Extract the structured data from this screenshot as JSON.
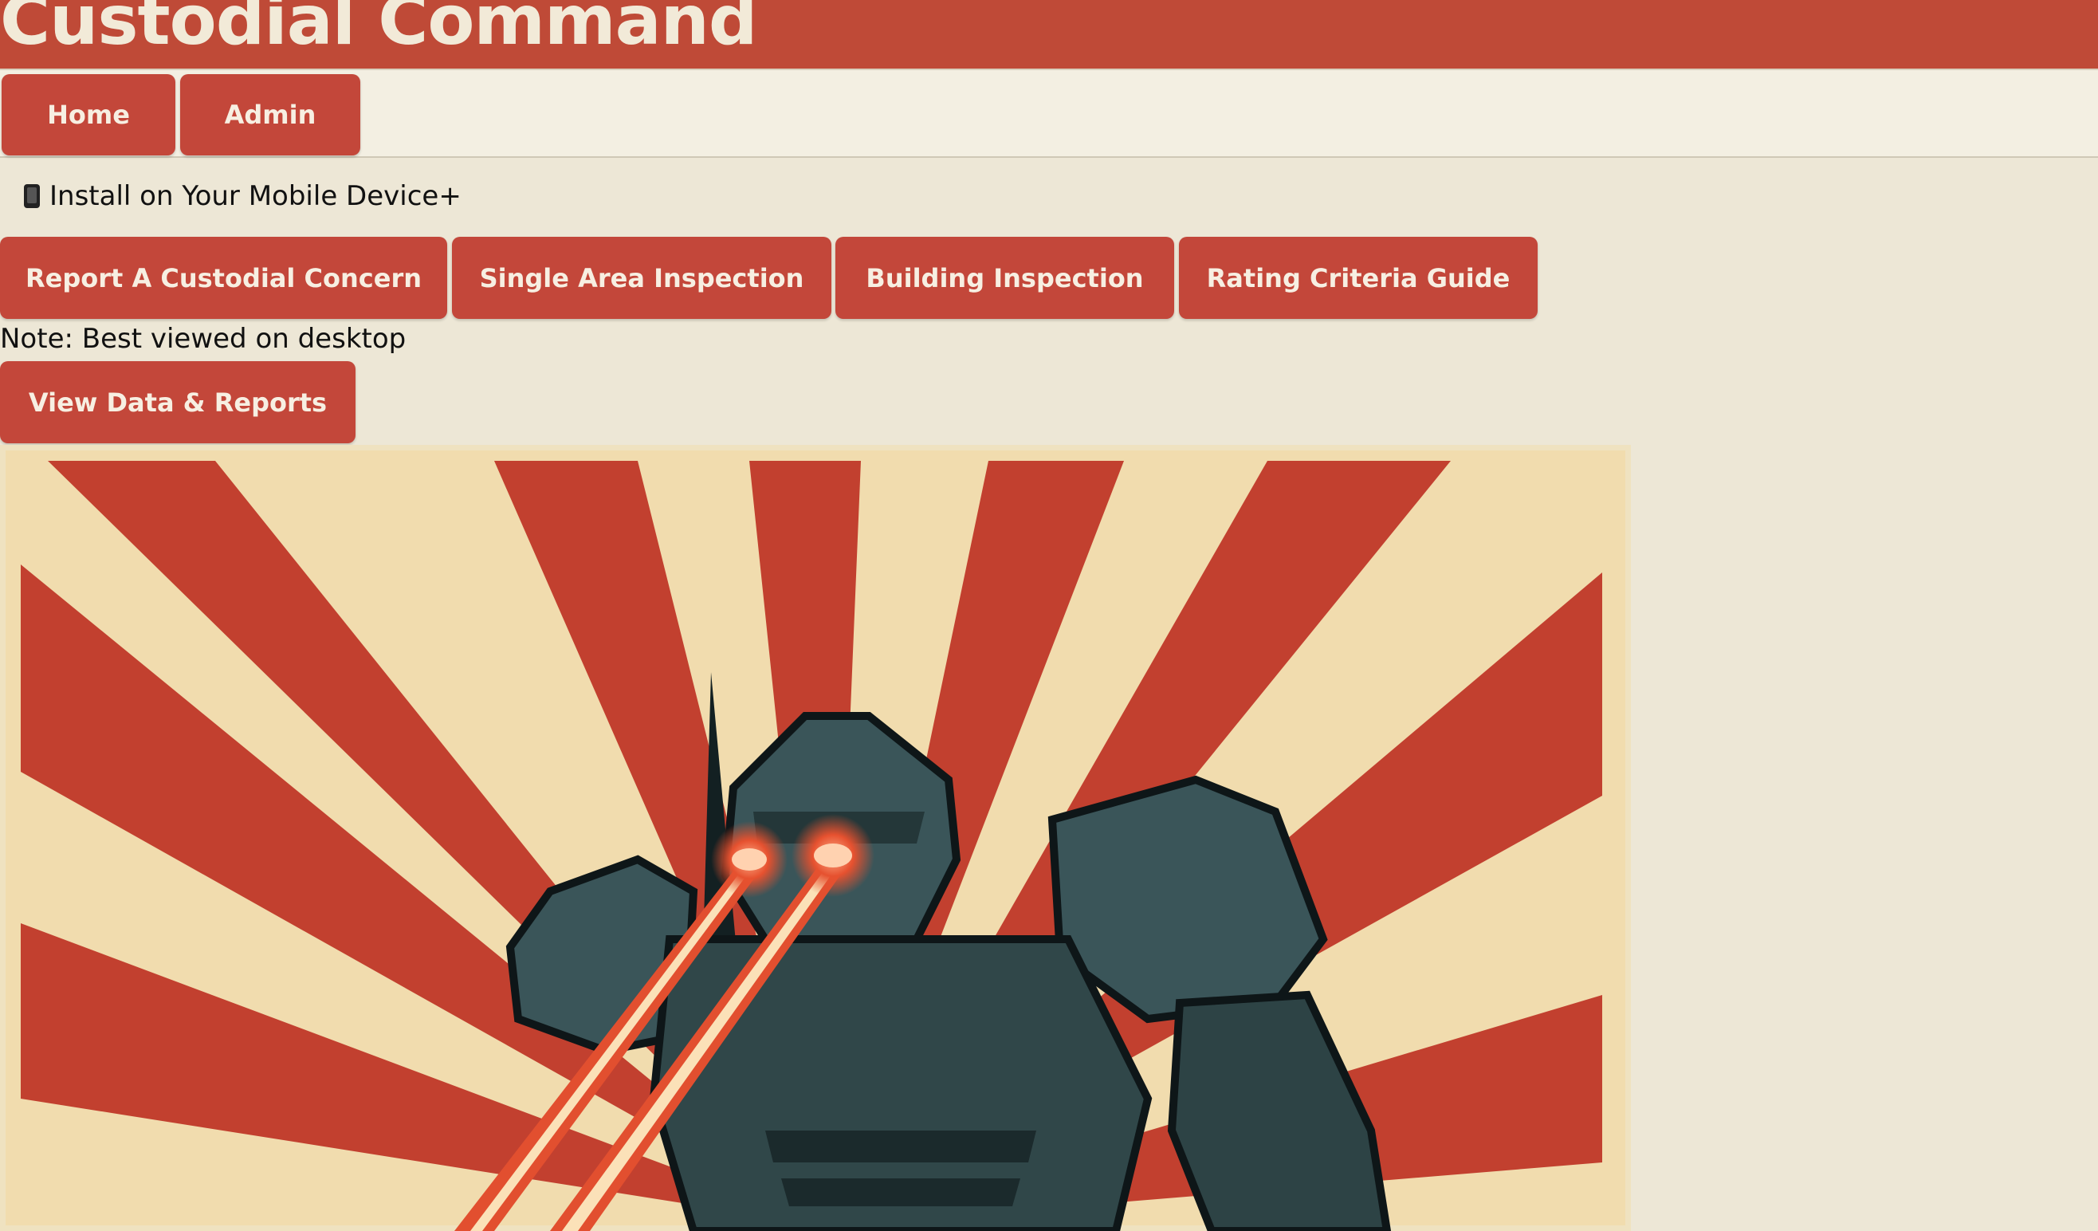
{
  "header": {
    "title": "Custodial Command"
  },
  "nav": {
    "items": [
      {
        "label": "Home"
      },
      {
        "label": "Admin"
      }
    ]
  },
  "install": {
    "label": "Install on Your Mobile Device+",
    "icon": "mobile-phone-icon"
  },
  "actions": [
    {
      "label": "Report A Custodial Concern"
    },
    {
      "label": "Single Area Inspection"
    },
    {
      "label": "Building Inspection"
    },
    {
      "label": "Rating Criteria Guide"
    }
  ],
  "note": "Note: Best viewed on desktop",
  "reports_button": {
    "label": "View Data & Reports"
  },
  "colors": {
    "brand_red": "#bf4a37",
    "button_red": "#c3473a",
    "background": "#ede7d6",
    "nav_background": "#f3efe2",
    "title_text": "#f2ead8"
  }
}
